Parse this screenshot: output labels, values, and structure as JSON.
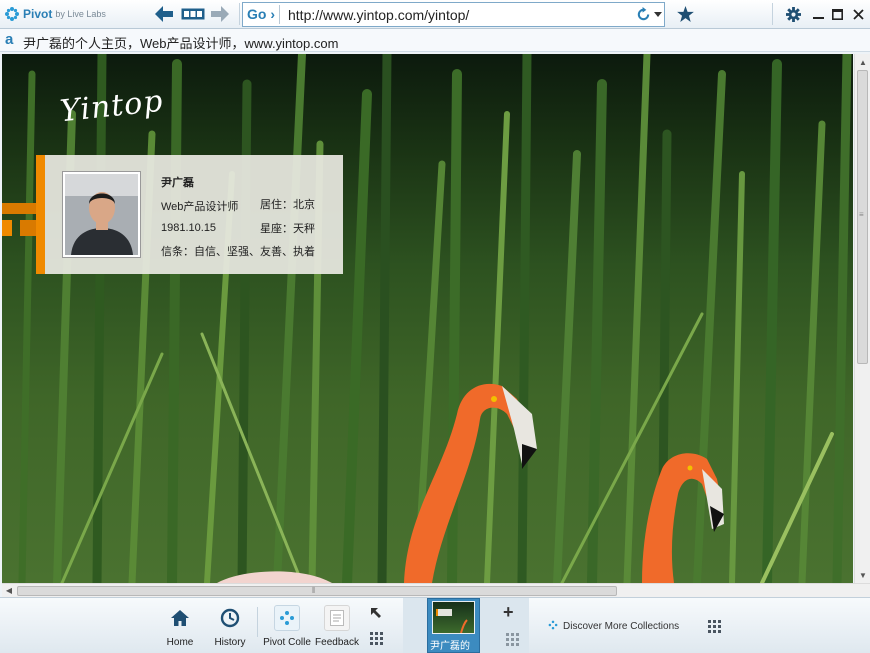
{
  "app": {
    "brand": "Pivot",
    "brand_by": "by Live Labs"
  },
  "address_bar": {
    "go_label": "Go ›",
    "url": "http://www.yintop.com/yintop/"
  },
  "tab": {
    "icon_glyph": "a",
    "title": "尹广磊的个人主页，Web产品设计师，www.yintop.com"
  },
  "page": {
    "signature": "Yintop",
    "profile": {
      "name": "尹广磊",
      "job": "Web产品设计师",
      "birthday": "1981.10.15",
      "residence": "居住：北京",
      "zodiac": "星座：天秤",
      "motto": "信条：自信、坚强、友善、执着"
    }
  },
  "bottom_bar": {
    "buttons": [
      {
        "label": "Home",
        "icon": "home-icon"
      },
      {
        "label": "History",
        "icon": "clock-icon"
      },
      {
        "label": "Pivot Colle",
        "icon": "pivot-icon"
      },
      {
        "label": "Feedback",
        "icon": "feedback-icon"
      }
    ],
    "thumbnail_label": "尹广磊的",
    "discover_label": "Discover More Collections"
  },
  "colors": {
    "accent": "#2a7fb5",
    "card_orange": "#f08a00",
    "selected_tab": "#3c8bc0"
  }
}
